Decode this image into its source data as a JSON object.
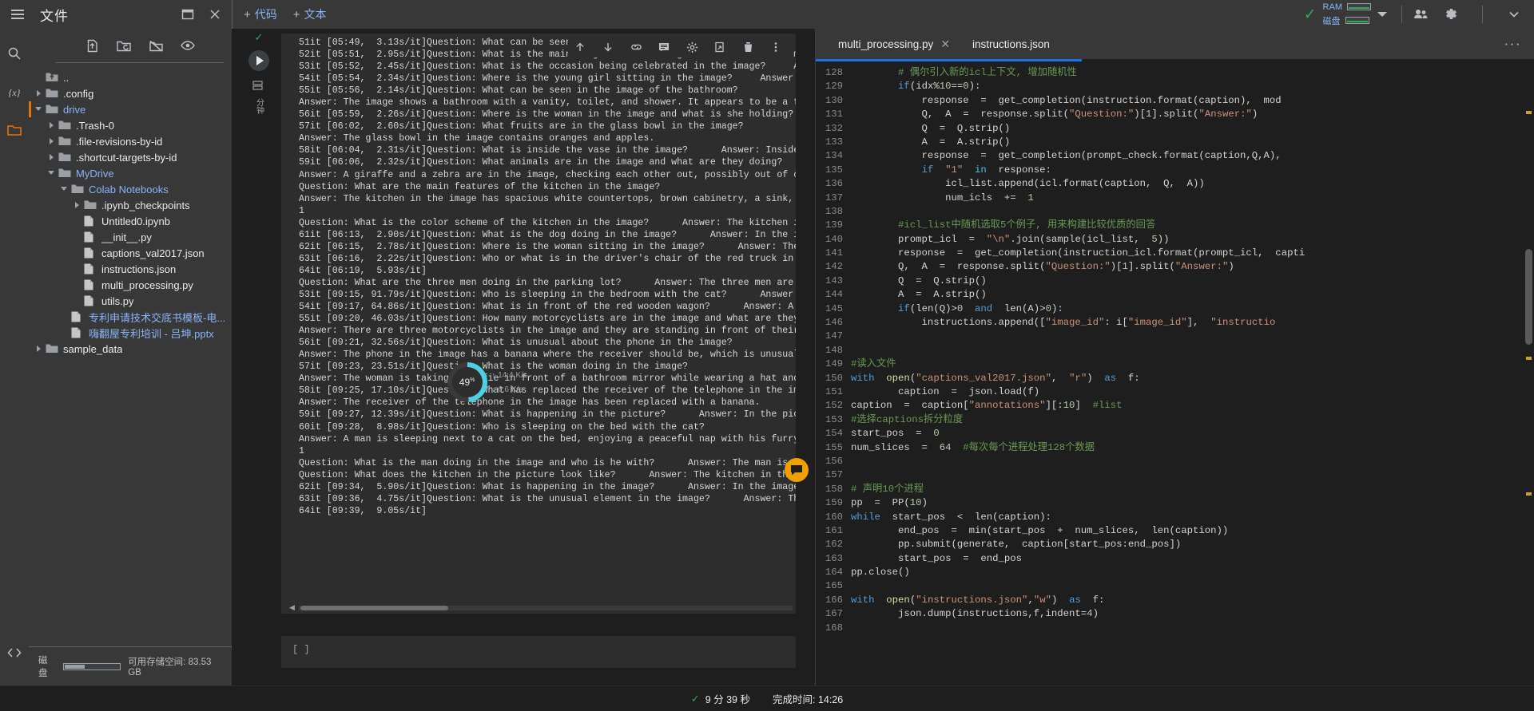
{
  "topbar": {
    "files_title": "文件",
    "hamburger_icon": "menu-icon",
    "dock_icon": "dock-window-icon",
    "close_icon": "close-icon",
    "add_code_label": "代码",
    "add_text_label": "文本",
    "plus": "+",
    "connected_check": "✓",
    "ram_label": "RAM",
    "disk_label": "磁盘",
    "share_icon": "people-icon",
    "settings_icon": "gear-icon",
    "expand_icon": "chevron-down-icon"
  },
  "rail": {
    "items": [
      {
        "name": "search-icon",
        "glyph": "search"
      },
      {
        "name": "variables-icon",
        "glyph": "{x}"
      },
      {
        "name": "files-icon",
        "glyph": "folder"
      },
      {
        "name": "code-snippets-icon",
        "glyph": "<>"
      }
    ]
  },
  "filebrowser": {
    "toolbar": [
      {
        "name": "upload-icon",
        "title": "上传"
      },
      {
        "name": "refresh-folder-icon",
        "title": "刷新"
      },
      {
        "name": "mount-drive-icon",
        "title": "装载云端硬盘"
      },
      {
        "name": "eye-icon",
        "title": "预览"
      }
    ],
    "tree": [
      {
        "label": "..",
        "depth": 0,
        "arrow": "none",
        "icon": "up-folder",
        "blue": false
      },
      {
        "label": ".config",
        "depth": 0,
        "arrow": "closed",
        "icon": "folder",
        "blue": false
      },
      {
        "label": "drive",
        "depth": 0,
        "arrow": "open",
        "icon": "folder",
        "blue": true,
        "selected": true
      },
      {
        "label": ".Trash-0",
        "depth": 1,
        "arrow": "closed",
        "icon": "folder",
        "blue": false
      },
      {
        "label": ".file-revisions-by-id",
        "depth": 1,
        "arrow": "closed",
        "icon": "folder",
        "blue": false
      },
      {
        "label": ".shortcut-targets-by-id",
        "depth": 1,
        "arrow": "closed",
        "icon": "folder",
        "blue": false
      },
      {
        "label": "MyDrive",
        "depth": 1,
        "arrow": "open",
        "icon": "folder",
        "blue": true
      },
      {
        "label": "Colab Notebooks",
        "depth": 2,
        "arrow": "open",
        "icon": "folder",
        "blue": true
      },
      {
        "label": ".ipynb_checkpoints",
        "depth": 3,
        "arrow": "closed",
        "icon": "folder",
        "blue": false
      },
      {
        "label": "Untitled0.ipynb",
        "depth": 3,
        "arrow": "none",
        "icon": "file",
        "blue": false
      },
      {
        "label": "__init__.py",
        "depth": 3,
        "arrow": "none",
        "icon": "file",
        "blue": false
      },
      {
        "label": "captions_val2017.json",
        "depth": 3,
        "arrow": "none",
        "icon": "file",
        "blue": false
      },
      {
        "label": "instructions.json",
        "depth": 3,
        "arrow": "none",
        "icon": "file",
        "blue": false
      },
      {
        "label": "multi_processing.py",
        "depth": 3,
        "arrow": "none",
        "icon": "file",
        "blue": false
      },
      {
        "label": "utils.py",
        "depth": 3,
        "arrow": "none",
        "icon": "file",
        "blue": false
      },
      {
        "label": "专利申请技术交底书模板-电...",
        "depth": 2,
        "arrow": "none",
        "icon": "file",
        "blue": true
      },
      {
        "label": "嗨翻屋专利培训 - 吕坤.pptx",
        "depth": 2,
        "arrow": "none",
        "icon": "file",
        "blue": true
      },
      {
        "label": "sample_data",
        "depth": 0,
        "arrow": "closed",
        "icon": "folder",
        "blue": false
      }
    ],
    "footer": {
      "disk_label": "磁盘",
      "storage_text": "可用存储空间: 83.53 GB"
    }
  },
  "notebook": {
    "cell": {
      "status_check": "✓",
      "elapsed_vertical": "分钟",
      "elapsed_number": "9",
      "run_icon": "play-icon",
      "stack_icon": "stacked-cells-icon"
    },
    "output_toolbar": [
      {
        "name": "scroll-up-icon"
      },
      {
        "name": "scroll-down-icon"
      },
      {
        "name": "link-icon"
      },
      {
        "name": "comment-icon"
      },
      {
        "name": "settings-icon"
      },
      {
        "name": "open-in-new-icon"
      },
      {
        "name": "delete-icon"
      },
      {
        "name": "more-vert-icon"
      }
    ],
    "output_text": "51it [05:49,  3.13s/it]Question: What can be seen in the image?      Answer: The imag\n52it [05:51,  2.95s/it]Question: What is the main subject of the image?      Answer: The main subject of the image is\n53it [05:52,  2.45s/it]Question: What is the occasion being celebrated in the image?     Answer: The occasion bei\n54it [05:54,  2.34s/it]Question: Where is the young girl sitting in the image?     Answer: The young girl is sitt\n55it [05:56,  2.14s/it]Question: What can be seen in the image of the bathroom?\nAnswer: The image shows a bathroom with a vanity, toilet, and shower. It appears to be a functional and modern bat\n56it [05:59,  2.26s/it]Question: Where is the woman in the image and what is she holding?     Answer: The woman is\n57it [06:02,  2.60s/it]Question: What fruits are in the glass bowl in the image?\nAnswer: The glass bowl in the image contains oranges and apples.\n58it [06:04,  2.31s/it]Question: What is inside the vase in the image?      Answer: Inside the vase in the image, \n59it [06:06,  2.32s/it]Question: What animals are in the image and what are they doing?\nAnswer: A giraffe and a zebra are in the image, checking each other out, possibly out of curiosity or to establish\nQuestion: What are the main features of the kitchen in the image?\nAnswer: The kitchen in the image has spacious white countertops, brown cabinetry, a sink, and appliances.\n1\nQuestion: What is the color scheme of the kitchen in the image?      Answer: The kitchen in the image has a spaciou\n61it [06:13,  2.90s/it]Question: What is the dog doing in the image?      Answer: In the image, a dog is sitting in\n62it [06:15,  2.78s/it]Question: Where is the woman sitting in the image?      Answer: The woman is sitting on a bu\n63it [06:16,  2.22s/it]Question: Who or what is in the driver's chair of the red truck in the image?      Answer: \n64it [06:19,  5.93s/it]\nQuestion: What are the three men doing in the parking lot?      Answer: The three men are standing around their mot\n53it [09:15, 91.79s/it]Question: Who is sleeping in the bedroom with the cat?      Answer: A man is sleeping in his\n54it [09:17, 64.86s/it]Question: What is in front of the red wooden wagon?      Answer: A set of toy animals is sit\n55it [09:20, 46.03s/it]Question: How many motorcyclists are in the image and what are they doing?\nAnswer: There are three motorcyclists in the image and they are standing in front of their motorcycles.\n56it [09:21, 32.56s/it]Question: What is unusual about the phone in the image?\nAnswer: The phone in the image has a banana where the receiver should be, which is unusual and unexpected.\n57it [09:23, 23.51s/it]Question: What is the woman doing in the image?\nAnswer: The woman is taking a selfie in front of a bathroom mirror while wearing a hat and pink top.\n58it [09:25, 17.10s/it]Question: What has replaced the receiver of the telephone in the image?\nAnswer: The receiver of the telephone in the image has been replaced with a banana.\n59it [09:27, 12.39s/it]Question: What is happening in the picture?      Answer: In the picture, a white cat has cau\n60it [09:28,  8.98s/it]Question: Who is sleeping on the bed with the cat?\nAnswer: A man is sleeping next to a cat on the bed, enjoying a peaceful nap with his furry companion.\n1\nQuestion: What is the man doing in the image and who is he with?      Answer: The man is sleeping next to a cat on \nQuestion: What does the kitchen in the picture look like?      Answer: The kitchen in the picture is small and has \n62it [09:34,  5.90s/it]Question: What is happening in the image?      Answer: In the image, a striped plane is fly\n63it [09:36,  4.75s/it]Question: What is the unusual element in the image?      Answer: The unusual element in the \n64it [09:39,  9.05s/it]",
    "next_cell_prompt": "[ ]",
    "progress": {
      "percent": "49",
      "percent_suffix": "%",
      "up_rate": "14.4",
      "down_rate": "6.6",
      "rate_unit": "K/s",
      "up_arrow": "↑",
      "down_arrow": "↓"
    }
  },
  "editor": {
    "tabs": [
      {
        "label": "multi_processing.py",
        "active": true,
        "closable": true
      },
      {
        "label": "instructions.json",
        "active": false,
        "closable": false
      }
    ],
    "more_icon": "more-horiz-icon",
    "first_line_number": 128,
    "lines": [
      {
        "n": 128,
        "html": "        <span class='cmt'># 偶尔引入新的icl上下文, 增加随机性</span>"
      },
      {
        "n": 129,
        "html": "        <span class='kw'>if</span>(idx%<span class='num'>10</span>==<span class='num'>0</span>):"
      },
      {
        "n": 130,
        "html": "            response  =  get_completion(instruction.format(caption),  mod"
      },
      {
        "n": 131,
        "html": "            Q,  A  =  response.split(<span class='str'>\"Question:\"</span>)[<span class='num'>1</span>].split(<span class='str'>\"Answer:\"</span>)"
      },
      {
        "n": 132,
        "html": "            Q  =  Q.strip()"
      },
      {
        "n": 133,
        "html": "            A  =  A.strip()"
      },
      {
        "n": 134,
        "html": "            response  =  get_completion(prompt_check.format(caption,Q,A),"
      },
      {
        "n": 135,
        "html": "            <span class='kw'>if</span>  <span class='str'>\"1\"</span>  <span class='kw2'>in</span>  response:"
      },
      {
        "n": 136,
        "html": "                icl_list.append(icl.format(caption,  Q,  A))"
      },
      {
        "n": 137,
        "html": "                num_icls  +=  <span class='num'>1</span>"
      },
      {
        "n": 138,
        "html": ""
      },
      {
        "n": 139,
        "html": "        <span class='cmt'>#icl_list中随机选取5个例子, 用来构建比较优质的回答</span>"
      },
      {
        "n": 140,
        "html": "        prompt_icl  =  <span class='str'>\"\\n\"</span>.join(sample(icl_list,  <span class='num'>5</span>))"
      },
      {
        "n": 141,
        "html": "        response  =  get_completion(instruction_icl.format(prompt_icl,  capti"
      },
      {
        "n": 142,
        "html": "        Q,  A  =  response.split(<span class='str'>\"Question:\"</span>)[<span class='num'>1</span>].split(<span class='str'>\"Answer:\"</span>)"
      },
      {
        "n": 143,
        "html": "        Q  =  Q.strip()"
      },
      {
        "n": 144,
        "html": "        A  =  A.strip()"
      },
      {
        "n": 145,
        "html": "        <span class='kw'>if</span>(len(Q)&gt;<span class='num'>0</span>  <span class='kw'>and</span>  len(A)&gt;<span class='num'>0</span>):"
      },
      {
        "n": 146,
        "html": "            instructions.append([<span class='str'>\"image_id\"</span>: i[<span class='str'>\"image_id\"</span>],  <span class='str'>\"instructio</span>"
      },
      {
        "n": 147,
        "html": ""
      },
      {
        "n": 148,
        "html": ""
      },
      {
        "n": 149,
        "html": "<span class='cmt'>#读入文件</span>"
      },
      {
        "n": 150,
        "html": "<span class='kw'>with</span>  <span class='fn'>open</span>(<span class='str'>\"captions_val2017.json\"</span>,  <span class='str'>\"r\"</span>)  <span class='kw'>as</span>  f:"
      },
      {
        "n": 151,
        "html": "        caption  =  json.load(f)"
      },
      {
        "n": 152,
        "html": "caption  =  caption[<span class='str'>\"annotations\"</span>][:<span class='num'>10</span>]  <span class='cmt'>#list</span>"
      },
      {
        "n": 153,
        "html": "<span class='cmt'>#选择captions拆分粒度</span>"
      },
      {
        "n": 154,
        "html": "start_pos  =  <span class='num'>0</span>"
      },
      {
        "n": 155,
        "html": "num_slices  =  <span class='num'>64</span>  <span class='cmt'>#每次每个进程处理128个数据</span>"
      },
      {
        "n": 156,
        "html": ""
      },
      {
        "n": 157,
        "html": ""
      },
      {
        "n": 158,
        "html": "<span class='cmt'># 声明10个进程</span>"
      },
      {
        "n": 159,
        "html": "pp  =  PP(<span class='num'>10</span>)"
      },
      {
        "n": 160,
        "html": "<span class='kw'>while</span>  start_pos  &lt;  len(caption):"
      },
      {
        "n": 161,
        "html": "        end_pos  =  min(start_pos  +  num_slices,  len(caption))"
      },
      {
        "n": 162,
        "html": "        pp.submit(generate,  caption[start_pos:end_pos])"
      },
      {
        "n": 163,
        "html": "        start_pos  =  end_pos"
      },
      {
        "n": 164,
        "html": "pp.close()"
      },
      {
        "n": 165,
        "html": ""
      },
      {
        "n": 166,
        "html": "<span class='kw'>with</span>  <span class='fn'>open</span>(<span class='str'>\"instructions.json\"</span>,<span class='str'>\"w\"</span>)  <span class='kw'>as</span>  f:"
      },
      {
        "n": 167,
        "html": "        json.dump(instructions,f,indent=<span class='num'>4</span>)"
      },
      {
        "n": 168,
        "html": ""
      }
    ]
  },
  "statusbar": {
    "check": "✓",
    "elapsed": "9 分 39 秒",
    "finished": "完成时间: 14:26"
  }
}
